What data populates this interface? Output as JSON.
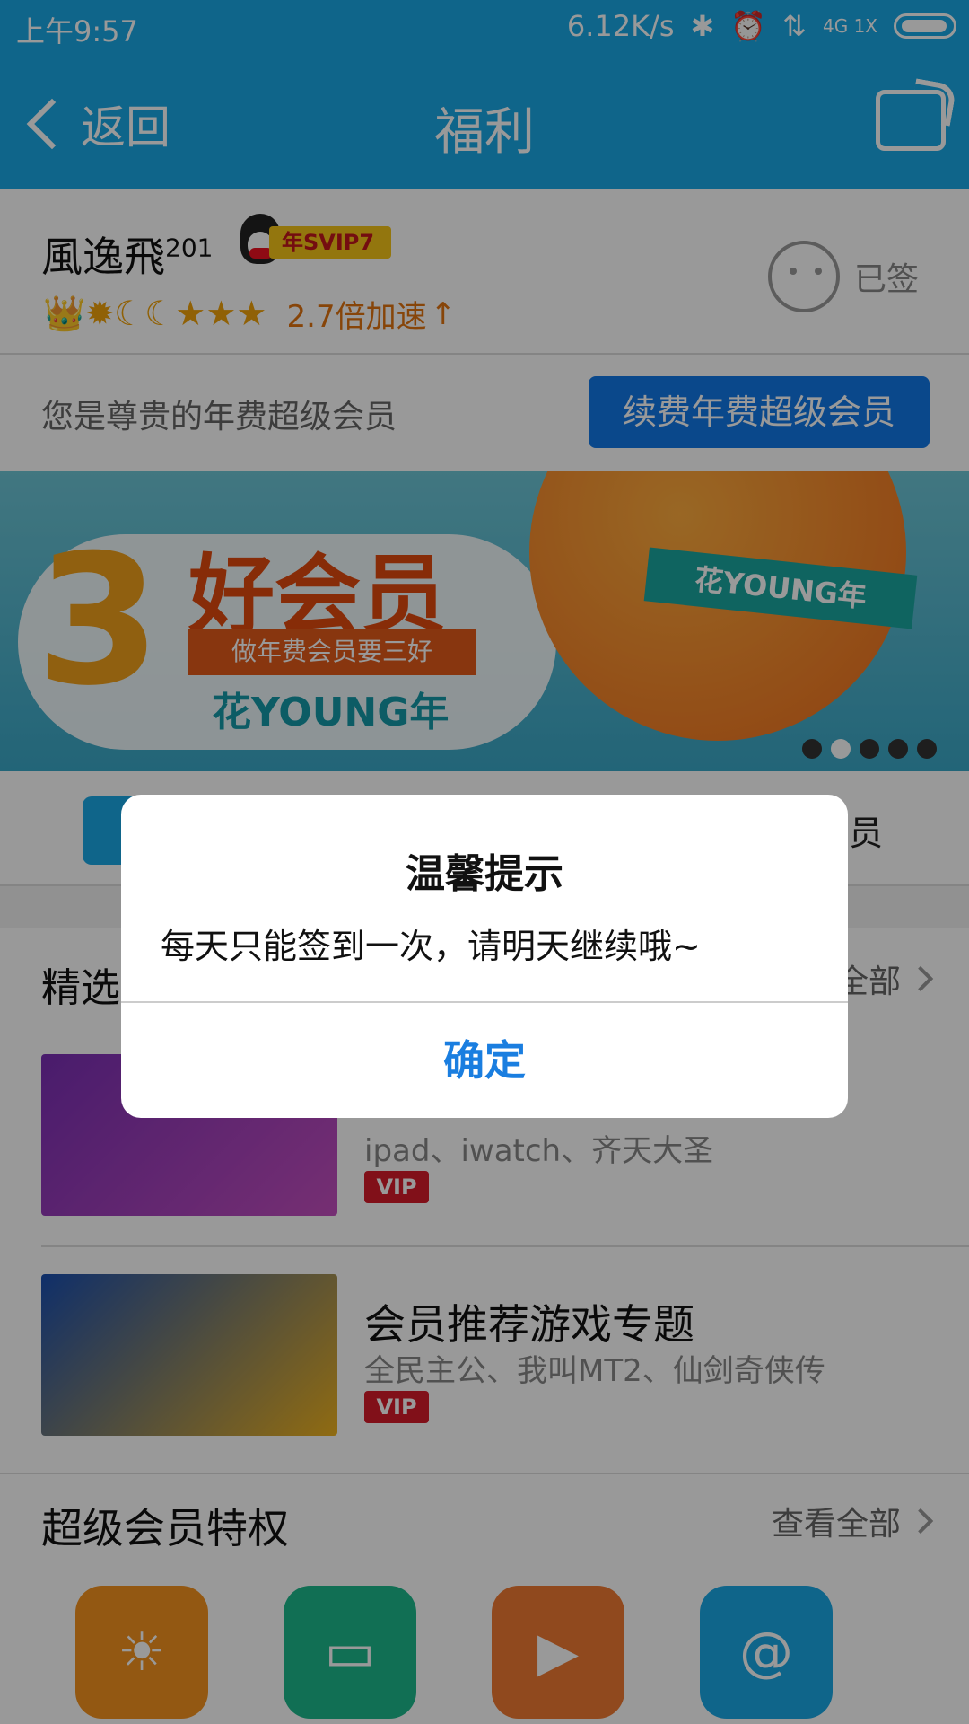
{
  "status_bar": {
    "time": "上午9:57",
    "speed": "6.12K/s",
    "network": "4G 1X"
  },
  "header": {
    "back_label": "返回",
    "title": "福利"
  },
  "profile": {
    "username": "風逸飛",
    "superscript": "201",
    "badge": "年SVIP7",
    "level_icons": "👑✹☾☾★★★",
    "speed_text": "2.7倍加速",
    "speed_arrow": "↑",
    "signed_label": "已签"
  },
  "membership": {
    "text": "您是尊贵的年费超级会员",
    "renew_button": "续费年费超级会员"
  },
  "banner": {
    "number": "3",
    "headline": "好会员",
    "ribbon": "做年费会员要三好",
    "slogan": "花YOUNG年",
    "flag": "花YOUNG年"
  },
  "row_partial": {
    "right_text": "员"
  },
  "featured": {
    "title": "精选",
    "more": "全部",
    "items": [
      {
        "name": "",
        "sub": "ipad、iwatch、齐天大圣",
        "vip": "VIP"
      },
      {
        "name": "会员推荐游戏专题",
        "sub": "全民主公、我叫MT2、仙剑奇侠传",
        "vip": "VIP"
      }
    ]
  },
  "privileges": {
    "title": "超级会员特权",
    "more": "查看全部",
    "icons": [
      {
        "name": "sun-smile-icon",
        "color": "#f6931e"
      },
      {
        "name": "chat-bow-icon",
        "color": "#1db98c"
      },
      {
        "name": "video-camera-icon",
        "color": "#f07a32"
      },
      {
        "name": "at-mail-icon",
        "color": "#1aa8e6"
      }
    ]
  },
  "dialog": {
    "title": "温馨提示",
    "message": "每天只能签到一次，请明天继续哦~",
    "confirm": "确定"
  }
}
